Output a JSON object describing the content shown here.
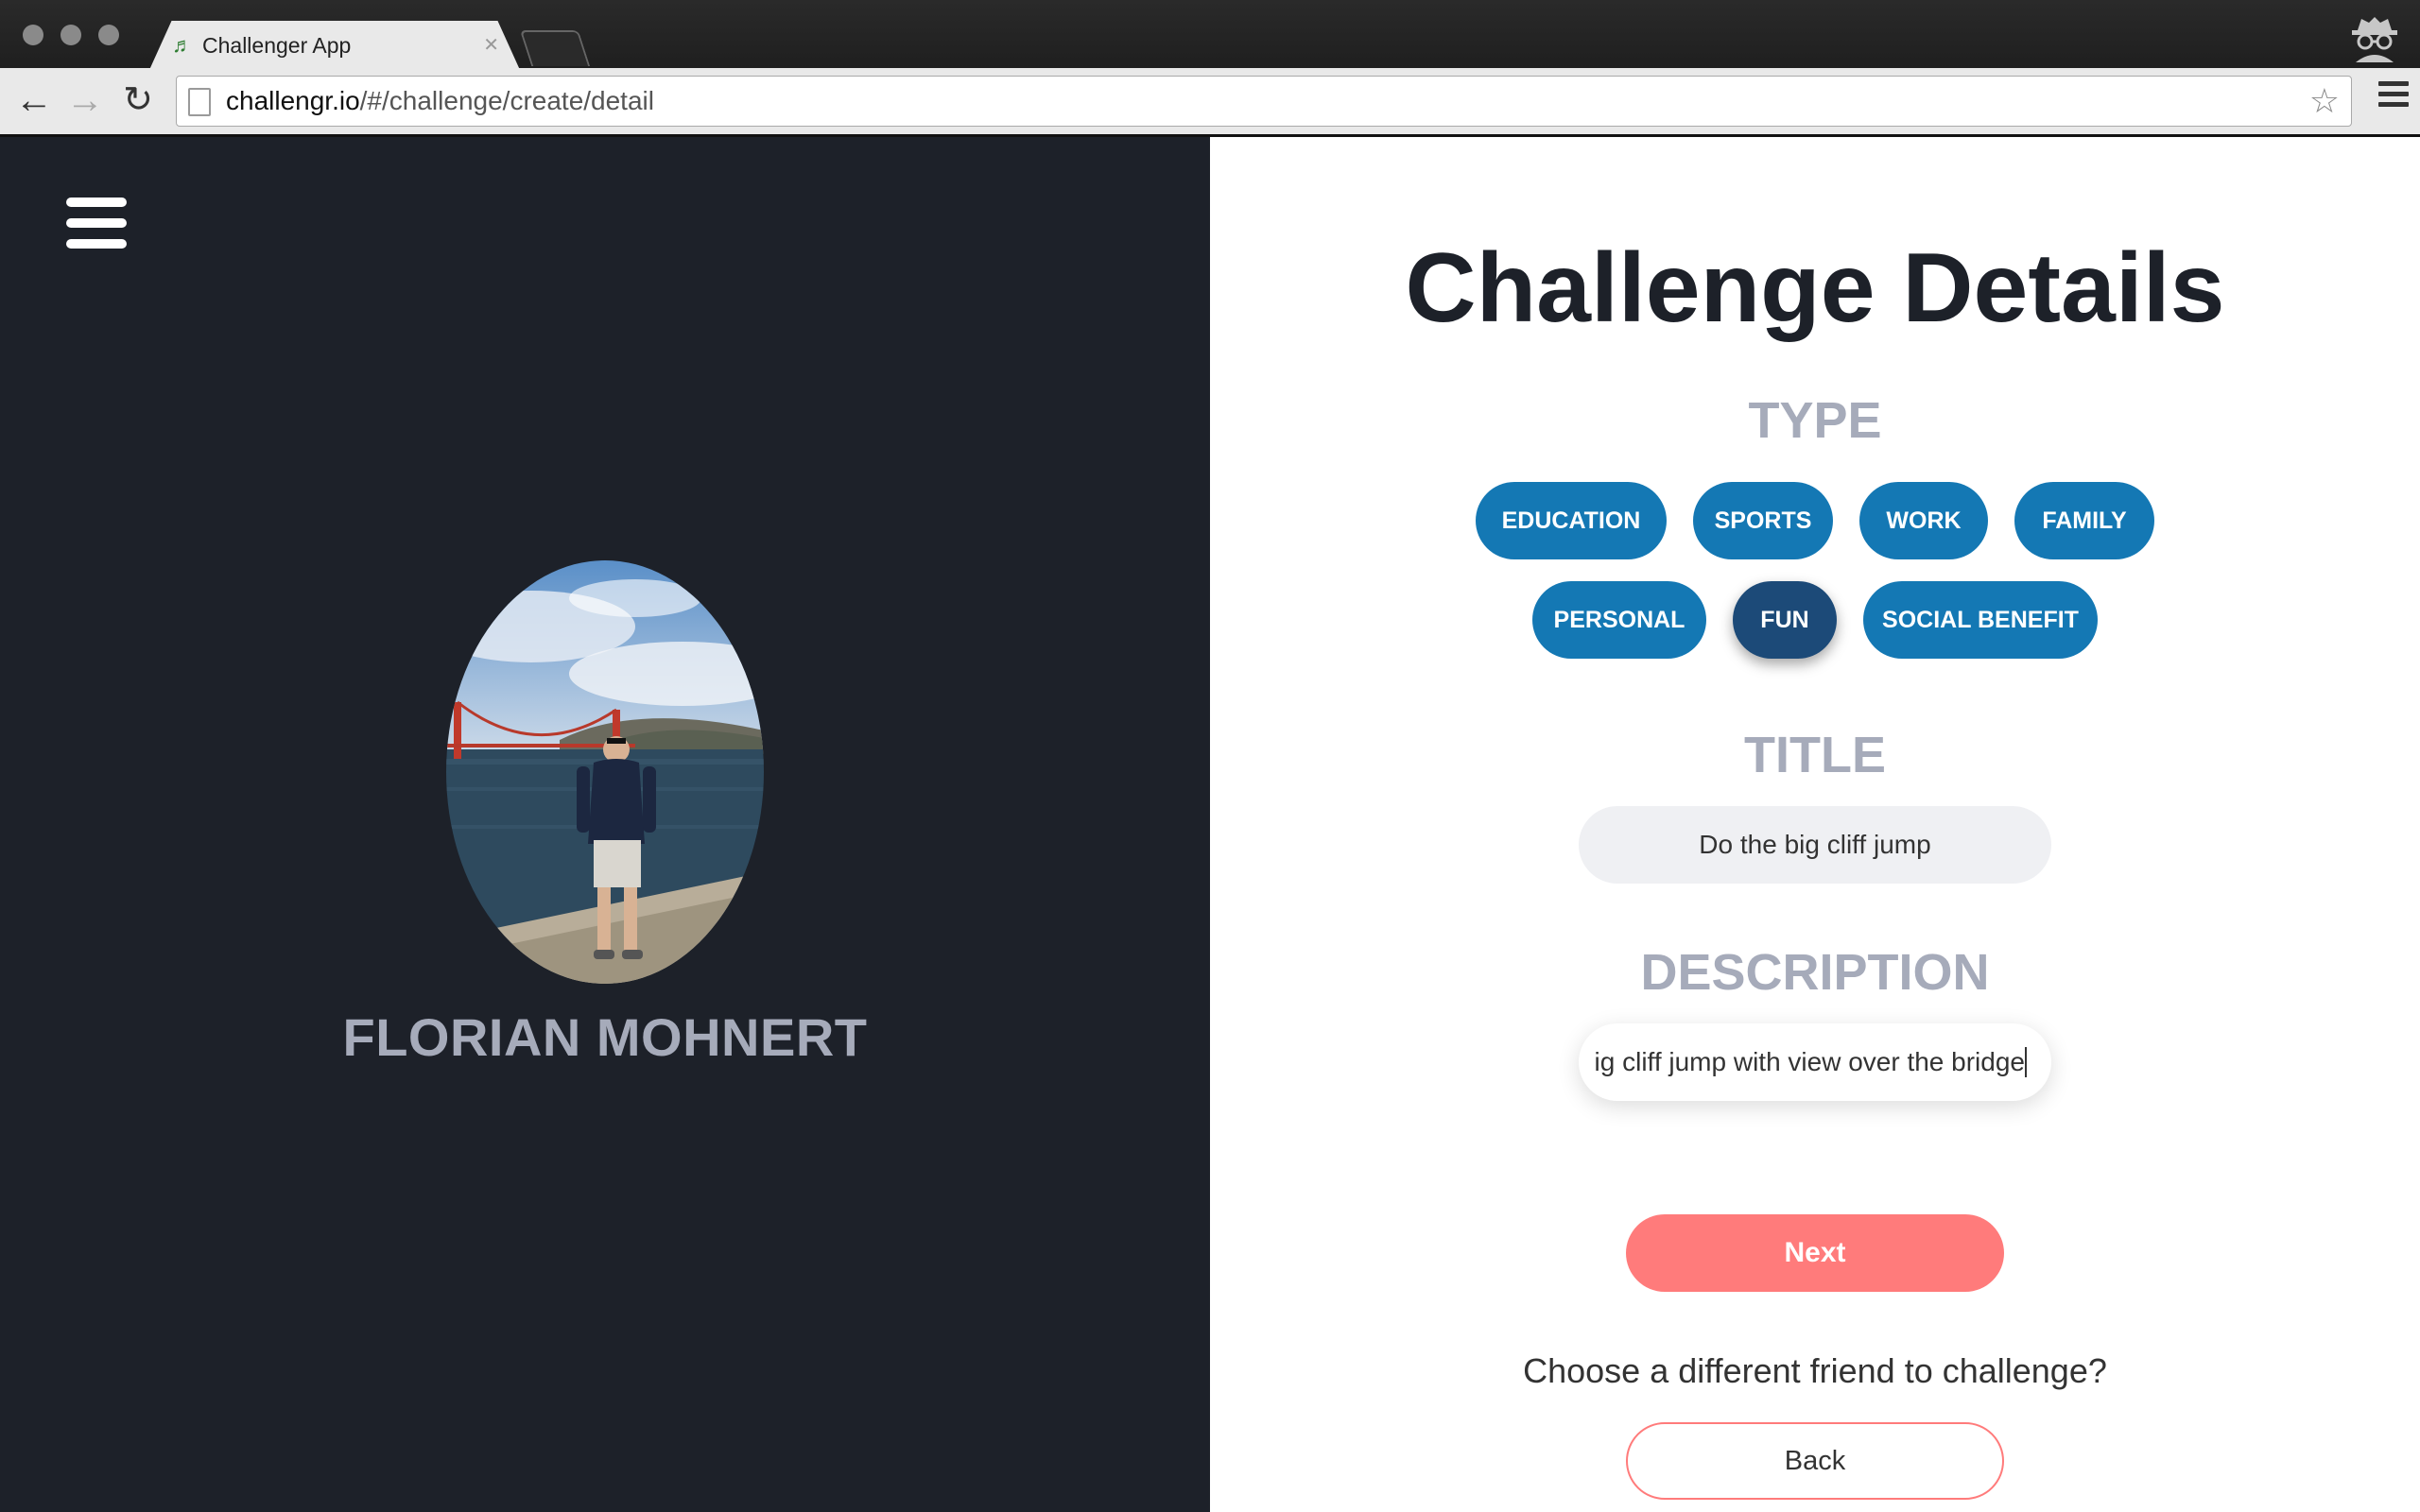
{
  "browser": {
    "tab_title": "Challenger App",
    "url_host": "challengr.io",
    "url_path": "/#/challenge/create/detail"
  },
  "profile": {
    "name": "FLORIAN MOHNERT"
  },
  "form": {
    "heading": "Challenge Details",
    "type_label": "TYPE",
    "types_row1": [
      "EDUCATION",
      "SPORTS",
      "WORK",
      "FAMILY"
    ],
    "types_row2": [
      "PERSONAL",
      "FUN",
      "SOCIAL BENEFIT"
    ],
    "selected_type": "FUN",
    "title_label": "TITLE",
    "title_value": "Do the big cliff jump",
    "description_label": "DESCRIPTION",
    "description_value": "ig cliff jump with view over the bridge",
    "next_label": "Next",
    "prompt": "Choose a different friend to challenge?",
    "back_label": "Back"
  },
  "colors": {
    "pill": "#1478b4",
    "pill_selected": "#1c4a78",
    "accent": "#ff7b7b",
    "left_panel": "#1d2129",
    "label": "#a6abba"
  }
}
